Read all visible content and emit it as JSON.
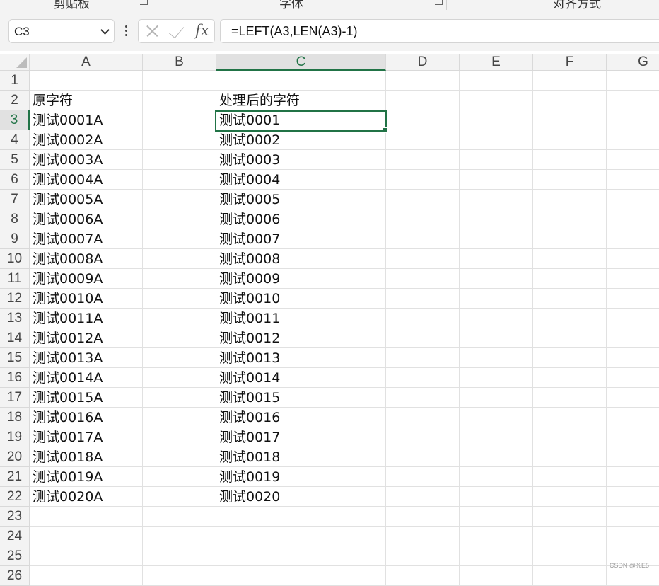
{
  "ribbon": {
    "groups": [
      {
        "label": "剪贴板"
      },
      {
        "label": "字体"
      },
      {
        "label": "对齐方式"
      }
    ]
  },
  "formula_bar": {
    "name_box": "C3",
    "formula": "=LEFT(A3,LEN(A3)-1)",
    "icons": [
      "cancel-icon",
      "enter-icon",
      "fx-icon"
    ],
    "fx_label": "fx"
  },
  "sheet": {
    "columns": [
      "A",
      "B",
      "C",
      "D",
      "E",
      "F",
      "G"
    ],
    "active_column": "C",
    "active_row": 3,
    "rows": [
      {
        "n": "1",
        "A": "",
        "C": ""
      },
      {
        "n": "2",
        "A": "原字符",
        "C": "处理后的字符"
      },
      {
        "n": "3",
        "A": "测试0001A",
        "C": "测试0001"
      },
      {
        "n": "4",
        "A": "测试0002A",
        "C": "测试0002"
      },
      {
        "n": "5",
        "A": "测试0003A",
        "C": "测试0003"
      },
      {
        "n": "6",
        "A": "测试0004A",
        "C": "测试0004"
      },
      {
        "n": "7",
        "A": "测试0005A",
        "C": "测试0005"
      },
      {
        "n": "8",
        "A": "测试0006A",
        "C": "测试0006"
      },
      {
        "n": "9",
        "A": "测试0007A",
        "C": "测试0007"
      },
      {
        "n": "10",
        "A": "测试0008A",
        "C": "测试0008"
      },
      {
        "n": "11",
        "A": "测试0009A",
        "C": "测试0009"
      },
      {
        "n": "12",
        "A": "测试0010A",
        "C": "测试0010"
      },
      {
        "n": "13",
        "A": "测试0011A",
        "C": "测试0011"
      },
      {
        "n": "14",
        "A": "测试0012A",
        "C": "测试0012"
      },
      {
        "n": "15",
        "A": "测试0013A",
        "C": "测试0013"
      },
      {
        "n": "16",
        "A": "测试0014A",
        "C": "测试0014"
      },
      {
        "n": "17",
        "A": "测试0015A",
        "C": "测试0015"
      },
      {
        "n": "18",
        "A": "测试0016A",
        "C": "测试0016"
      },
      {
        "n": "19",
        "A": "测试0017A",
        "C": "测试0017"
      },
      {
        "n": "20",
        "A": "测试0018A",
        "C": "测试0018"
      },
      {
        "n": "21",
        "A": "测试0019A",
        "C": "测试0019"
      },
      {
        "n": "22",
        "A": "测试0020A",
        "C": "测试0020"
      },
      {
        "n": "23",
        "A": "",
        "C": ""
      },
      {
        "n": "24",
        "A": "",
        "C": ""
      },
      {
        "n": "25",
        "A": "",
        "C": ""
      },
      {
        "n": "26",
        "A": "",
        "C": ""
      }
    ]
  },
  "watermark": "CSDN @%E5"
}
